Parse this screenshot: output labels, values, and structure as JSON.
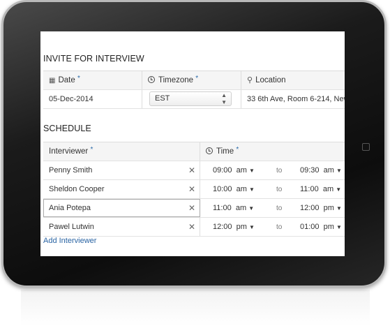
{
  "invite": {
    "title": "INVITE FOR INTERVIEW",
    "headers": {
      "date": "Date",
      "timezone": "Timezone",
      "location": "Location",
      "required_mark": "*"
    },
    "date_value": "05-Dec-2014",
    "timezone_value": "EST",
    "location_value": "33 6th Ave, Room 6-214, New"
  },
  "schedule": {
    "title": "SCHEDULE",
    "headers": {
      "interviewer": "Interviewer",
      "time": "Time"
    },
    "separator": "to",
    "rows": [
      {
        "name": "Penny Smith",
        "start": "09:00",
        "start_ampm": "am",
        "end": "09:30",
        "end_ampm": "am"
      },
      {
        "name": "Sheldon Cooper",
        "start": "10:00",
        "start_ampm": "am",
        "end": "11:00",
        "end_ampm": "am"
      },
      {
        "name": "Ania Potepa",
        "start": "11:00",
        "start_ampm": "am",
        "end": "12:00",
        "end_ampm": "pm"
      },
      {
        "name": "Pawel Lutwin",
        "start": "12:00",
        "start_ampm": "pm",
        "end": "01:00",
        "end_ampm": "pm"
      }
    ],
    "add_link": "Add Interviewer"
  },
  "icons": {
    "remove": "close-icon",
    "dropdown": "caret-down-icon",
    "date": "calendar-icon",
    "time": "clock-icon",
    "location": "map-pin-icon"
  },
  "colors": {
    "link": "#2a64a3",
    "required": "#2a6aa8",
    "header_bg": "#f5f5f5"
  }
}
